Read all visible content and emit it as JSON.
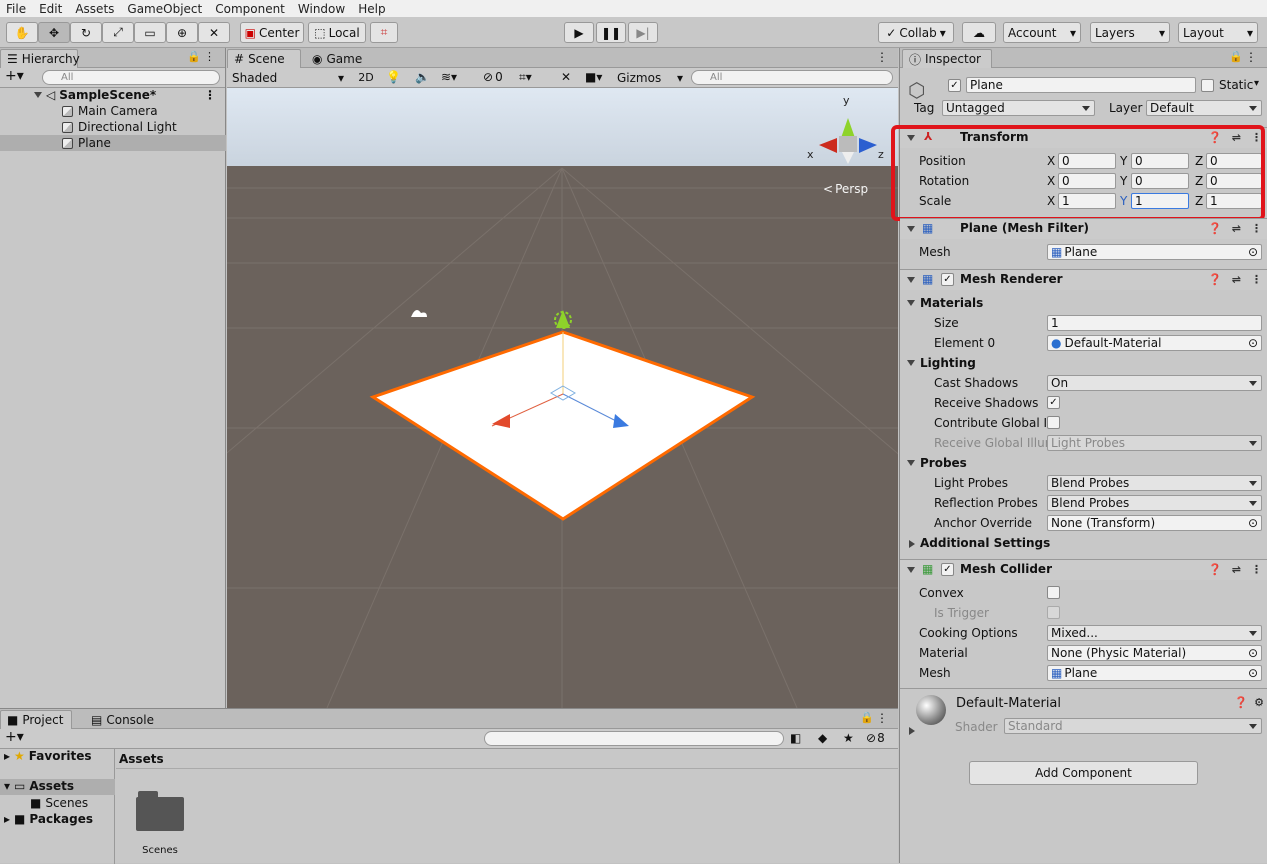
{
  "menu": [
    "File",
    "Edit",
    "Assets",
    "GameObject",
    "Component",
    "Window",
    "Help"
  ],
  "toolbar": {
    "center": "Center",
    "local": "Local",
    "collab": "Collab",
    "account": "Account",
    "layers": "Layers",
    "layout": "Layout"
  },
  "hierarchy": {
    "tab": "Hierarchy",
    "search": "All",
    "scene": "SampleScene*",
    "items": [
      "Main Camera",
      "Directional Light",
      "Plane"
    ]
  },
  "scene": {
    "tab_scene": "Scene",
    "tab_game": "Game",
    "shading": "Shaded",
    "mode2d": "2D",
    "hidden_count": "0",
    "gizmos": "Gizmos",
    "search": "All",
    "persp": "Persp",
    "axis_x": "x",
    "axis_y": "y",
    "axis_z": "z"
  },
  "project": {
    "tab_project": "Project",
    "tab_console": "Console",
    "favorites": "Favorites",
    "assets": "Assets",
    "scenes": "Scenes",
    "packages": "Packages",
    "breadcrumb": "Assets",
    "folder": "Scenes",
    "hidden_count": "8"
  },
  "inspector": {
    "tab": "Inspector",
    "name": "Plane",
    "static": "Static",
    "tag_label": "Tag",
    "tag": "Untagged",
    "layer_label": "Layer",
    "layer": "Default",
    "transform": {
      "title": "Transform",
      "position_label": "Position",
      "rotation_label": "Rotation",
      "scale_label": "Scale",
      "axis_x": "X",
      "axis_y": "Y",
      "axis_z": "Z",
      "position": [
        "0",
        "0",
        "0"
      ],
      "rotation": [
        "0",
        "0",
        "0"
      ],
      "scale": [
        "1",
        "1",
        "1"
      ]
    },
    "mesh_filter": {
      "title": "Plane (Mesh Filter)",
      "mesh_label": "Mesh",
      "mesh": "Plane"
    },
    "mesh_renderer": {
      "title": "Mesh Renderer",
      "materials": "Materials",
      "size_label": "Size",
      "size": "1",
      "element0_label": "Element 0",
      "element0": "Default-Material",
      "lighting": "Lighting",
      "cast_shadows_label": "Cast Shadows",
      "cast_shadows": "On",
      "receive_shadows_label": "Receive Shadows",
      "contribute_gi_label": "Contribute Global Ill",
      "receive_gi_label": "Receive Global Illun",
      "receive_gi": "Light Probes",
      "probes": "Probes",
      "light_probes_label": "Light Probes",
      "light_probes": "Blend Probes",
      "reflection_probes_label": "Reflection Probes",
      "reflection_probes": "Blend Probes",
      "anchor_label": "Anchor Override",
      "anchor": "None (Transform)",
      "additional": "Additional Settings"
    },
    "mesh_collider": {
      "title": "Mesh Collider",
      "convex_label": "Convex",
      "is_trigger_label": "Is Trigger",
      "cooking_label": "Cooking Options",
      "cooking": "Mixed...",
      "material_label": "Material",
      "material": "None (Physic Material)",
      "mesh_label": "Mesh",
      "mesh": "Plane"
    },
    "material": {
      "name": "Default-Material",
      "shader_label": "Shader",
      "shader": "Standard"
    },
    "add_component": "Add Component"
  },
  "colors": {
    "highlight": "#e0141b",
    "selection": "#ff6a00",
    "sky": "#dfe8f2",
    "ground": "#6b625c"
  }
}
